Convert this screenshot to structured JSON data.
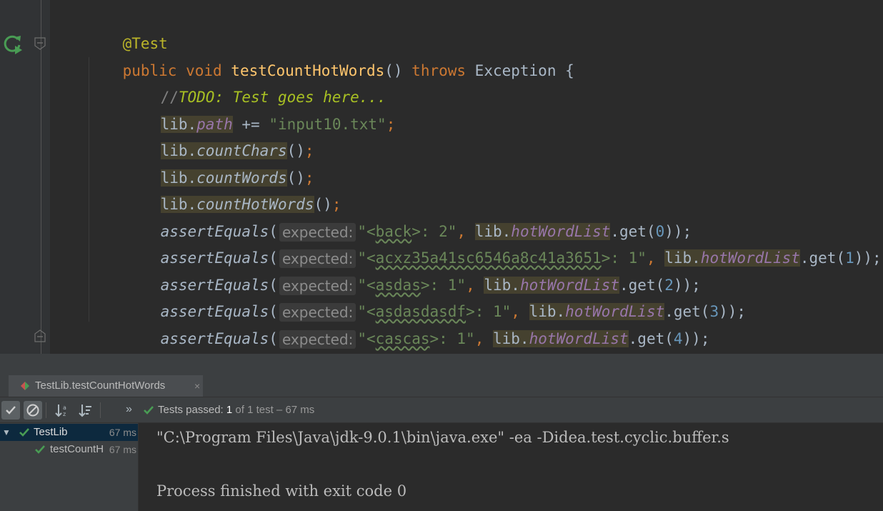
{
  "editor": {
    "annotation": "@Test",
    "method_decl": {
      "modifiers": "public void ",
      "name": "testCountHotWords",
      "parens": "() ",
      "throws_kw": "throws",
      "exception": " Exception {"
    },
    "todo": {
      "slashes": "//",
      "text": "TODO: Test goes here..."
    },
    "lines": {
      "path": {
        "obj": "lib.",
        "field": "path",
        "op": " += ",
        "str": "\"input10.txt\"",
        "end": ";"
      },
      "chars": {
        "obj": "lib.",
        "method": "countChars",
        "call": "()",
        "end": ";"
      },
      "words": {
        "obj": "lib.",
        "method": "countWords",
        "call": "()",
        "end": ";"
      },
      "hot": {
        "obj": "lib.",
        "method": "countHotWords",
        "call": "()",
        "end": ";"
      }
    },
    "assert_method": "assertEquals",
    "param_hint": "expected:",
    "field_name": "hotWordList",
    "get_call": ".get(",
    "asserts": [
      {
        "q": "\"<",
        "word": "back",
        "tail": ">: 2\"",
        "idx": "0",
        "close": "));"
      },
      {
        "q": "\"<",
        "word": "acxz35a41sc6546a8c41a3651",
        "tail": ">: 1\"",
        "idx": "1",
        "close": "));"
      },
      {
        "q": "\"<",
        "word": "asdas",
        "tail": ">: 1\"",
        "idx": "2",
        "close": "));"
      },
      {
        "q": "\"<",
        "word": "asdasdasdf",
        "tail": ">: 1\"",
        "idx": "3",
        "close": "));"
      },
      {
        "q": "\"<",
        "word": "cascas",
        "tail": ">: 1\"",
        "idx": "4",
        "close": "));"
      }
    ],
    "closing_brace": "}"
  },
  "run_panel": {
    "tab_label": "TestLib.testCountHotWords",
    "tab_close": "×",
    "status": {
      "prefix": "Tests passed: ",
      "count": "1",
      "rest": " of 1 test – 67 ms"
    },
    "chevrons": "»",
    "tree": [
      {
        "label": "TestLib",
        "duration": "67 ms"
      },
      {
        "label": "testCountH",
        "duration": "67 ms"
      }
    ],
    "console": [
      "\"C:\\Program Files\\Java\\jdk-9.0.1\\bin\\java.exe\" -ea -Didea.test.cyclic.buffer.s",
      "",
      "Process finished with exit code 0"
    ]
  },
  "colors": {
    "background": "#2b2b2b",
    "keyword": "#cc7832",
    "string": "#6a8759",
    "number": "#6897bb",
    "field": "#9876aa",
    "method_decl": "#ffc66d",
    "todo": "#a8c023",
    "pass_green": "#499c54"
  }
}
